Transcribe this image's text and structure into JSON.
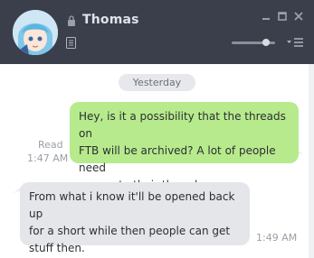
{
  "header": {
    "contact_name": "Thomas",
    "volume_level": 0.8,
    "icons": [
      "avatar",
      "lock-icon",
      "profile-icon",
      "minimize-icon",
      "maximize-icon",
      "close-icon",
      "volume-slider",
      "menu-icon"
    ]
  },
  "chat": {
    "date_divider": "Yesterday",
    "messages": [
      {
        "direction": "outgoing",
        "lines": [
          "Hey, is it a possibility that the threads on",
          "FTB will be archived? A lot of people need",
          "access to their threads"
        ],
        "status": "Read",
        "time": "1:47 AM"
      },
      {
        "direction": "incoming",
        "lines": [
          "From what i know it'll be opened back up",
          "for a short while then people can get",
          "stuff then."
        ],
        "time": "1:49 AM"
      }
    ]
  },
  "colors": {
    "titlebar": "#3b3f4c",
    "outgoing_bubble": "#b7ea8c",
    "incoming_bubble": "#e4e6e9",
    "date_pill": "#e6e8eb"
  }
}
